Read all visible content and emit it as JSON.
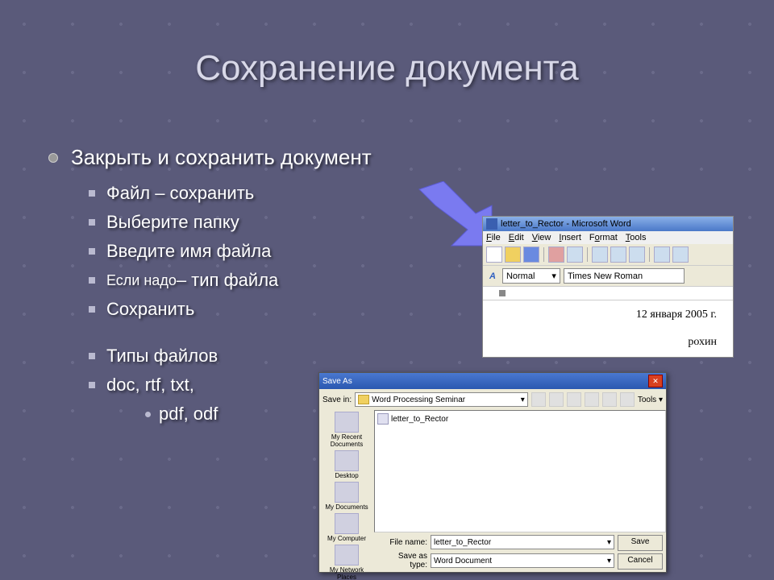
{
  "slide": {
    "title": "Сохранение документа",
    "main": "Закрыть и сохранить документ",
    "items": [
      "Файл – сохранить",
      "Выберите папку",
      "Введите имя файла",
      "",
      "Сохранить",
      "",
      "Типы файлов",
      "doc, rtf, txt,"
    ],
    "item_mixed_prefix": "Если надо ",
    "item_mixed_suffix": "– тип файла",
    "sub3": "pdf, odf"
  },
  "word": {
    "title": "letter_to_Rector - Microsoft Word",
    "menu": {
      "file": "File",
      "edit": "Edit",
      "view": "View",
      "insert": "Insert",
      "format": "Format",
      "tools": "Tools"
    },
    "style_label": "A",
    "style": "Normal",
    "font": "Times New Roman",
    "date": "12 января 2005 г.",
    "name_fragment": "рохин"
  },
  "saveas": {
    "title": "Save As",
    "save_in_label": "Save in:",
    "save_in_value": "Word Processing Seminar",
    "tools_label": "Tools",
    "side": [
      "My Recent Documents",
      "Desktop",
      "My Documents",
      "My Computer",
      "My Network Places"
    ],
    "list_item": "letter_to_Rector",
    "file_name_label": "File name:",
    "file_name_value": "letter_to_Rector",
    "save_as_type_label": "Save as type:",
    "save_as_type_value": "Word Document",
    "save_btn": "Save",
    "cancel_btn": "Cancel"
  }
}
